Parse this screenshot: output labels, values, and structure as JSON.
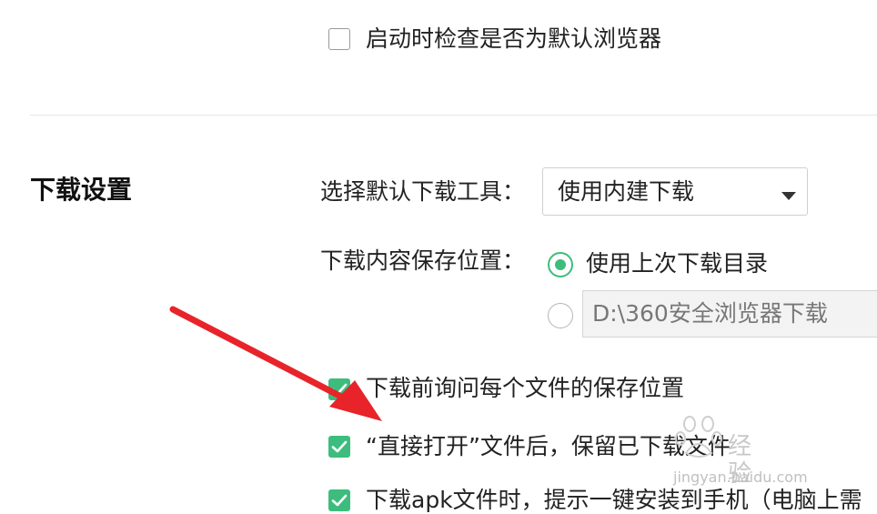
{
  "top_setting": {
    "default_browser_check": {
      "label": "启动时检查是否为默认浏览器",
      "checked": false
    }
  },
  "download_section": {
    "title": "下载设置",
    "tool": {
      "label": "选择默认下载工具：",
      "selected": "使用内建下载"
    },
    "save_location": {
      "label": "下载内容保存位置：",
      "options": [
        {
          "label": "使用上次下载目录",
          "selected": true
        },
        {
          "path": "D:\\360安全浏览器下载",
          "selected": false
        }
      ]
    },
    "checkboxes": [
      {
        "label": "下载前询问每个文件的保存位置",
        "checked": true
      },
      {
        "label": "“直接打开”文件后，保留已下载文件",
        "checked": true
      },
      {
        "label": "下载apk文件时，提示一键安装到手机（电脑上需",
        "checked": true
      }
    ]
  },
  "watermark": {
    "text": "经验",
    "url": "jingyan.baidu.com"
  },
  "colors": {
    "accent_green": "#3dbd7d",
    "arrow_red": "#e8232a"
  }
}
